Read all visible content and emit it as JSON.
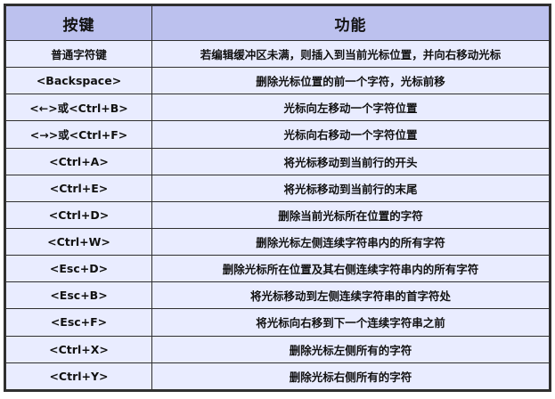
{
  "table": {
    "headers": [
      "按键",
      "功能"
    ],
    "rows": [
      {
        "key": "普通字符键",
        "function": "若编辑缓冲区未满，则插入到当前光标位置，并向右移动光标"
      },
      {
        "key": "<Backspace>",
        "function": "删除光标位置的前一个字符，光标前移"
      },
      {
        "key": "<←>或<Ctrl+B>",
        "function": "光标向左移动一个字符位置"
      },
      {
        "key": "<→>或<Ctrl+F>",
        "function": "光标向右移动一个字符位置"
      },
      {
        "key": "<Ctrl+A>",
        "function": "将光标移动到当前行的开头"
      },
      {
        "key": "<Ctrl+E>",
        "function": "将光标移动到当前行的末尾"
      },
      {
        "key": "<Ctrl+D>",
        "function": "删除当前光标所在位置的字符"
      },
      {
        "key": "<Ctrl+W>",
        "function": "删除光标左侧连续字符串内的所有字符"
      },
      {
        "key": "<Esc+D>",
        "function": "删除光标所在位置及其右侧连续字符串内的所有字符"
      },
      {
        "key": "<Esc+B>",
        "function": "将光标移动到左侧连续字符串的首字符处"
      },
      {
        "key": "<Esc+F>",
        "function": "将光标向右移到下一个连续字符串之前"
      },
      {
        "key": "<Ctrl+X>",
        "function": "删除光标左侧所有的字符"
      },
      {
        "key": "<Ctrl+Y>",
        "function": "删除光标右侧所有的字符"
      }
    ]
  },
  "colors": {
    "header_bg": "#bcc1ee",
    "cell_bg": "#e9ecff",
    "border": "#2f2f2f"
  }
}
